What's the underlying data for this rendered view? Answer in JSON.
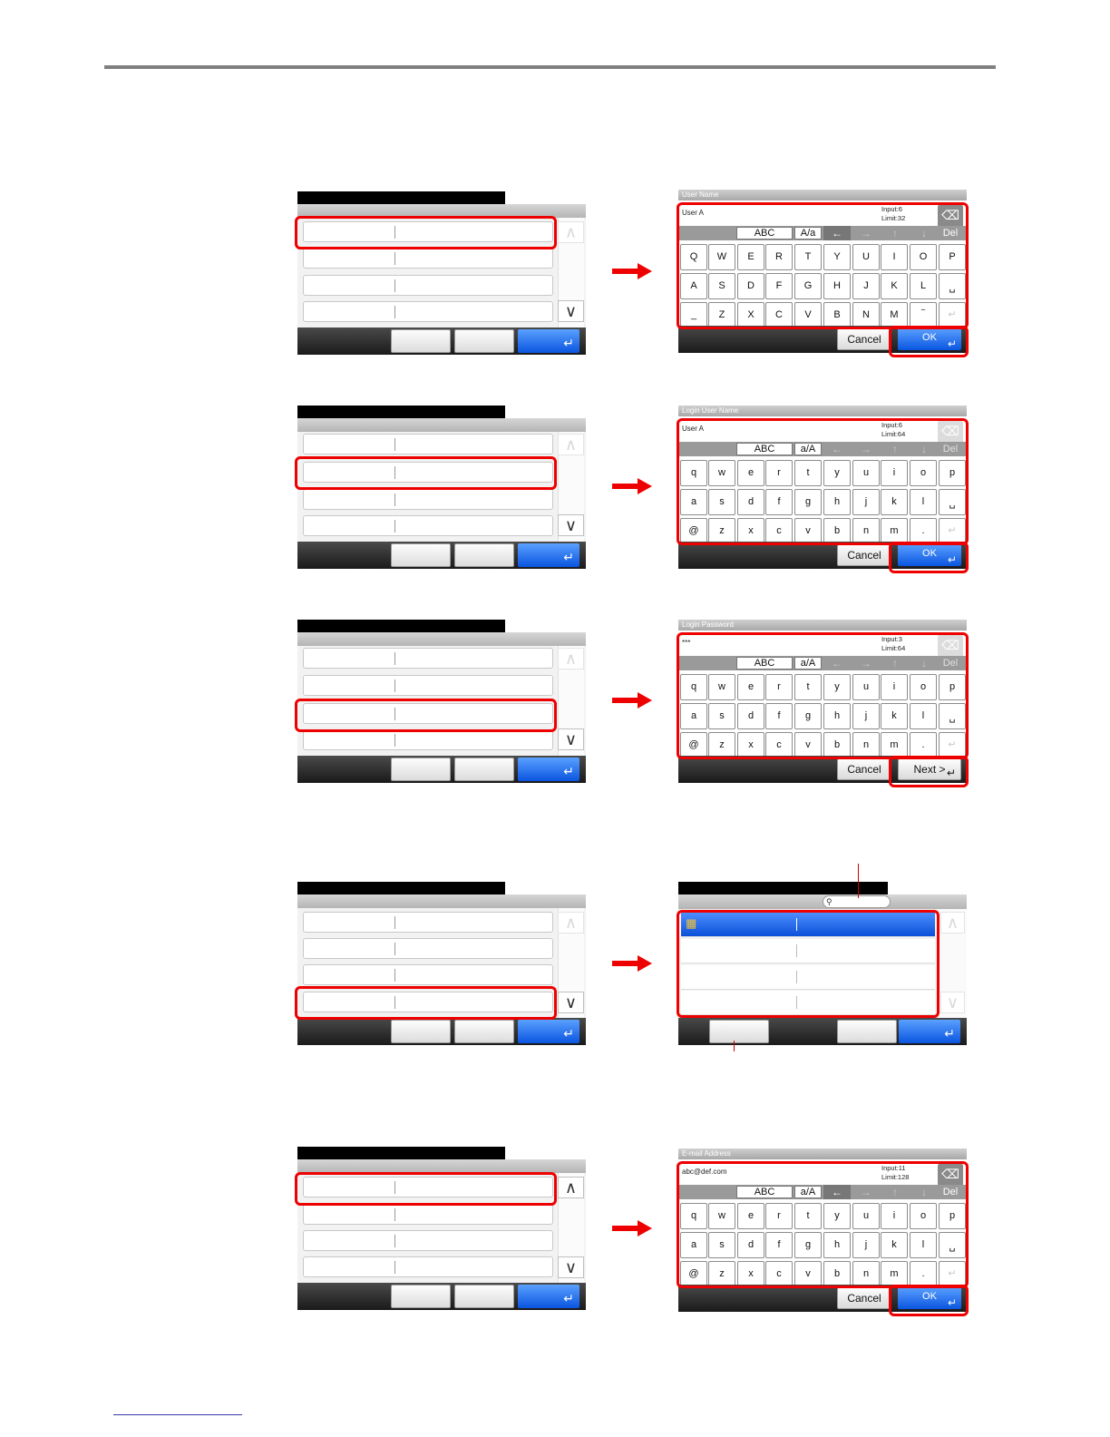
{
  "icons": {
    "scroll_up": "chevron-up-icon",
    "scroll_down": "chevron-down-icon",
    "enter": "enter-icon",
    "backspace": "backspace-icon",
    "search": "search-icon",
    "group": "address-group-icon"
  },
  "colors": {
    "highlight": "#e00000",
    "arrow": "#e00000",
    "ok_blue": "#0a55e0"
  },
  "glyphs": {
    "up": "∧",
    "down": "∨",
    "enter": "↵",
    "bksp": "⌫",
    "left": "←",
    "right": "→",
    "uarr": "↑",
    "darr": "↓",
    "group": "▦",
    "search": "🔍"
  },
  "keyboards": [
    {
      "title": "User Name",
      "value": "User A",
      "input_count": "Input:6",
      "limit": "Limit:32",
      "mode_abc": "ABC",
      "mode_case": "A/a",
      "del": "Del",
      "rows": [
        [
          "Q",
          "W",
          "E",
          "R",
          "T",
          "Y",
          "U",
          "I",
          "O",
          "P"
        ],
        [
          "A",
          "S",
          "D",
          "F",
          "G",
          "H",
          "J",
          "K",
          "L",
          "␣"
        ],
        [
          "_",
          "Z",
          "X",
          "C",
          "V",
          "B",
          "N",
          "M",
          "‾",
          "↵"
        ]
      ],
      "cancel": "Cancel",
      "ok": "OK"
    },
    {
      "title": "Login User Name",
      "value": "User A",
      "input_count": "Input:6",
      "limit": "Limit:64",
      "mode_abc": "ABC",
      "mode_case": "a/A",
      "del": "Del",
      "rows": [
        [
          "q",
          "w",
          "e",
          "r",
          "t",
          "y",
          "u",
          "i",
          "o",
          "p"
        ],
        [
          "a",
          "s",
          "d",
          "f",
          "g",
          "h",
          "j",
          "k",
          "l",
          "␣"
        ],
        [
          "@",
          "z",
          "x",
          "c",
          "v",
          "b",
          "n",
          "m",
          ".",
          "↵"
        ]
      ],
      "cancel": "Cancel",
      "ok": "OK"
    },
    {
      "title": "Login Password",
      "value": "***",
      "input_count": "Input:3",
      "limit": "Limit:64",
      "mode_abc": "ABC",
      "mode_case": "a/A",
      "del": "Del",
      "rows": [
        [
          "q",
          "w",
          "e",
          "r",
          "t",
          "y",
          "u",
          "i",
          "o",
          "p"
        ],
        [
          "a",
          "s",
          "d",
          "f",
          "g",
          "h",
          "j",
          "k",
          "l",
          "␣"
        ],
        [
          "@",
          "z",
          "x",
          "c",
          "v",
          "b",
          "n",
          "m",
          ".",
          "↵"
        ]
      ],
      "cancel": "Cancel",
      "ok": "Next >"
    },
    {
      "title": "E-mail Address",
      "value": "abc@def.com",
      "input_count": "Input:11",
      "limit": "Limit:128",
      "mode_abc": "ABC",
      "mode_case": "a/A",
      "del": "Del",
      "rows": [
        [
          "q",
          "w",
          "e",
          "r",
          "t",
          "y",
          "u",
          "i",
          "o",
          "p"
        ],
        [
          "a",
          "s",
          "d",
          "f",
          "g",
          "h",
          "j",
          "k",
          "l",
          "␣"
        ],
        [
          "@",
          "z",
          "x",
          "c",
          "v",
          "b",
          "n",
          "m",
          ".",
          "↵"
        ]
      ],
      "cancel": "Cancel",
      "ok": "OK"
    }
  ]
}
